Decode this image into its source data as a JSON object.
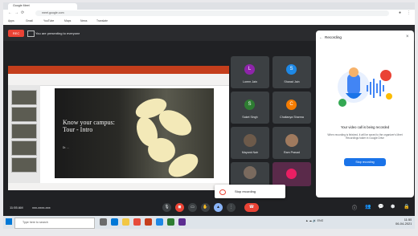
{
  "browser": {
    "tab_title": "Google Meet",
    "url": "meet.google.com",
    "bookmarks": [
      "Apps",
      "Gmail",
      "YouTube",
      "Maps",
      "News",
      "Translate"
    ]
  },
  "meet": {
    "recording_badge": "REC",
    "presenting_text": "You are presenting to everyone",
    "slide": {
      "title": "Know your campus: Tour - Intro",
      "subtitle": "Dr. ..."
    },
    "tiles": [
      {
        "name": "Lorem Jain",
        "initial": "L",
        "color": "#8e24aa"
      },
      {
        "name": "Sharad Jain",
        "initial": "S",
        "color": "#1e88e5"
      },
      {
        "name": "Saket Singh",
        "initial": "S",
        "color": "#2e7d32"
      },
      {
        "name": "Chaitanya Sharma",
        "initial": "C",
        "color": "#f57c00"
      },
      {
        "name": "Mayank Nair",
        "initial": "",
        "color": ""
      },
      {
        "name": "Ram Prasad",
        "initial": "",
        "color": ""
      },
      {
        "name": "",
        "initial": "",
        "color": ""
      },
      {
        "name": "",
        "initial": "",
        "color": "#e91e63"
      }
    ],
    "popup_text": "Stop recording",
    "meeting_time": "11:55 AM",
    "meeting_code": "xxx-xxxx-xxx"
  },
  "panel": {
    "title": "Recording",
    "heading": "Your video call is being recorded",
    "description": "When recording is finished, it will be saved to the organizer's Meet Recordings folder in Google Drive",
    "button": "Stop recording"
  },
  "taskbar": {
    "search_placeholder": "Type here to search",
    "time": "11:55",
    "date": "06-04-2021"
  },
  "colors": {
    "accent": "#1a73e8",
    "record": "#ea4335",
    "meet_bg": "#202124"
  }
}
